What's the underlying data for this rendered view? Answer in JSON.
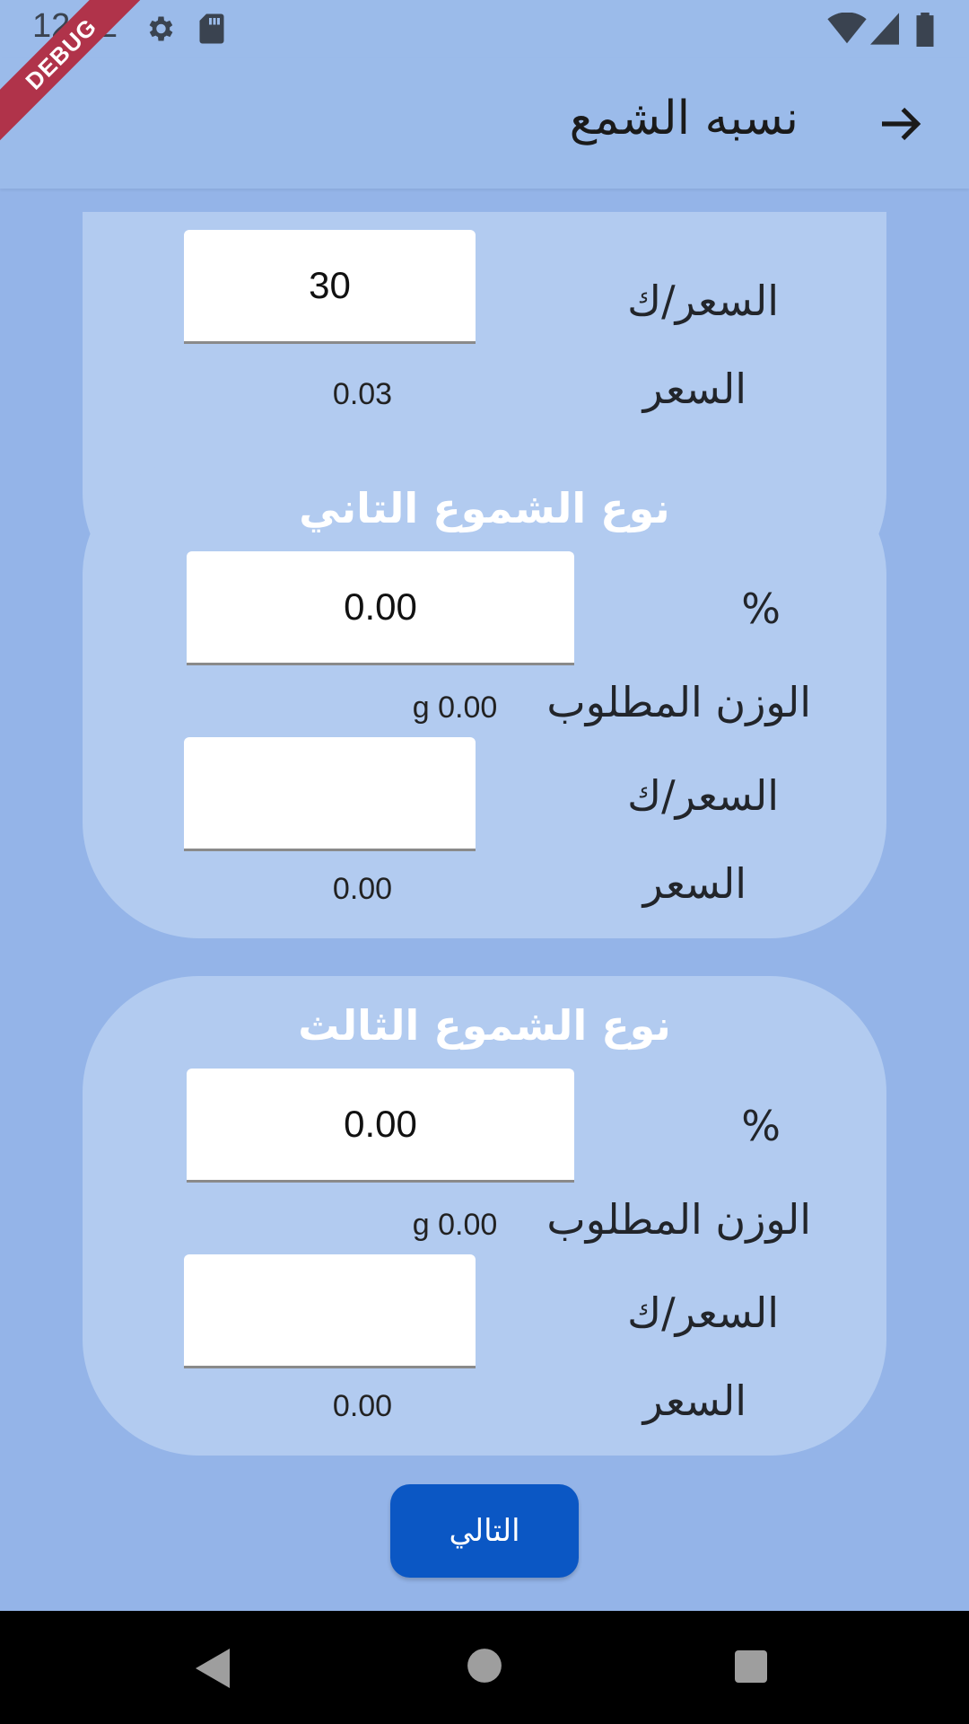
{
  "status_bar": {
    "time": "12:52",
    "icons": [
      "gear-icon",
      "sd-card-icon",
      "wifi-icon",
      "signal-icon",
      "battery-icon"
    ]
  },
  "debug_banner": "DEBUG",
  "app_bar": {
    "title": "نسبه الشمع",
    "back_icon": "arrow-right-icon"
  },
  "cards": [
    {
      "price_per_kg_label": "السعر/ك",
      "price_per_kg_value": "30",
      "price_label": "السعر",
      "price_value": "0.03"
    },
    {
      "title": "نوع الشموع التاني",
      "percent_label": "%",
      "percent_value": "0.00",
      "weight_label": "الوزن المطلوب",
      "weight_value": "g 0.00",
      "price_per_kg_label": "السعر/ك",
      "price_per_kg_value": "",
      "price_label": "السعر",
      "price_value": "0.00"
    },
    {
      "title": "نوع الشموع الثالث",
      "percent_label": "%",
      "percent_value": "0.00",
      "weight_label": "الوزن المطلوب",
      "weight_value": "g 0.00",
      "price_per_kg_label": "السعر/ك",
      "price_per_kg_value": "",
      "price_label": "السعر",
      "price_value": "0.00"
    }
  ],
  "next_button": "التالي",
  "nav_bar": {
    "icons": [
      "back-triangle-icon",
      "home-circle-icon",
      "recents-square-icon"
    ]
  },
  "colors": {
    "background": "#94b4e8",
    "card": "#b2cbf0",
    "app_bar": "#9bbbea",
    "primary_button": "#0b57c4",
    "debug_banner": "#b0334a"
  }
}
